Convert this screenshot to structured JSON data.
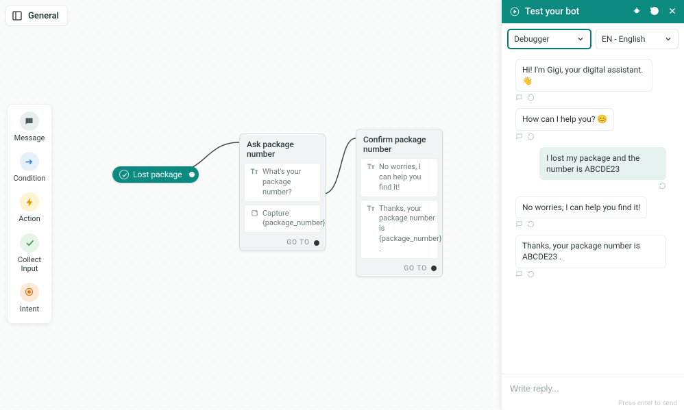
{
  "page_chip": {
    "label": "General"
  },
  "toolbox": {
    "items": [
      {
        "label": "Message"
      },
      {
        "label": "Condition"
      },
      {
        "label": "Action"
      },
      {
        "label": "Collect Input"
      },
      {
        "label": "Intent"
      }
    ]
  },
  "flow": {
    "start_node": {
      "label": "Lost package"
    },
    "node1": {
      "title": "Ask package number",
      "blocks": [
        {
          "icon": "text-icon",
          "text": "What's your package number?"
        },
        {
          "icon": "capture-icon",
          "text": "Capture {package_number}"
        }
      ],
      "goto": "GO TO"
    },
    "node2": {
      "title": "Confirm package number",
      "blocks": [
        {
          "icon": "text-icon",
          "text": "No worries, I can help you find it!"
        },
        {
          "icon": "text-icon",
          "text": "Thanks, your package number is {package_number} ."
        }
      ],
      "goto": "GO TO"
    }
  },
  "panel": {
    "title": "Test your bot",
    "debugger_label": "Debugger",
    "lang_label": "EN - English",
    "messages": [
      {
        "role": "bot",
        "text": "Hi! I'm Gigi, your digital assistant. 👋"
      },
      {
        "role": "bot",
        "text": "How can I help you? 😊"
      },
      {
        "role": "user",
        "text": "I lost my package and the number is ABCDE23"
      },
      {
        "role": "bot",
        "text": "No worries, I can help you find it!"
      },
      {
        "role": "bot",
        "text": "Thanks, your package number is ABCDE23 ."
      }
    ],
    "reply_placeholder": "Write reply...",
    "reply_hint": "Press enter to send"
  }
}
